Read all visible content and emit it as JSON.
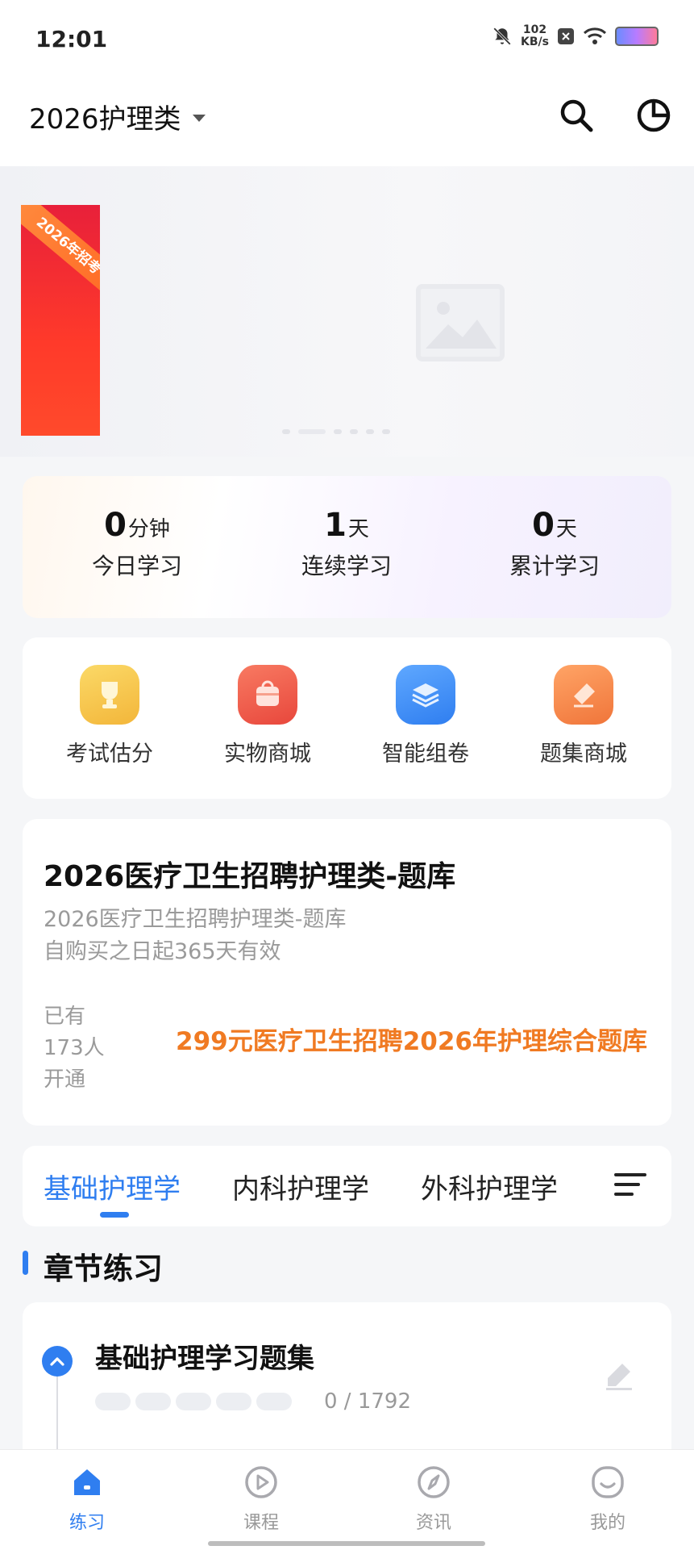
{
  "status_bar": {
    "time": "12:01",
    "net_speed_value": "102",
    "net_speed_unit": "KB/s"
  },
  "header": {
    "category": "2026护理类",
    "search_icon": "search-icon",
    "stats_icon": "pie-chart-icon"
  },
  "banner": {
    "promo_ribbon": "2026年招考"
  },
  "stats": [
    {
      "value": "0",
      "unit": "分钟",
      "label": "今日学习"
    },
    {
      "value": "1",
      "unit": "天",
      "label": "连续学习"
    },
    {
      "value": "0",
      "unit": "天",
      "label": "累计学习"
    }
  ],
  "quick_menu": [
    {
      "label": "考试估分",
      "icon": "trophy-icon",
      "color": "#f7c64a"
    },
    {
      "label": "实物商城",
      "icon": "bag-icon",
      "color": "#f0574a"
    },
    {
      "label": "智能组卷",
      "icon": "layers-icon",
      "color": "#3c8ef5"
    },
    {
      "label": "题集商城",
      "icon": "eraser-icon",
      "color": "#f58a4a"
    }
  ],
  "product": {
    "title": "2026医疗卫生招聘护理类-题库",
    "subtitle": "2026医疗卫生招聘护理类-题库",
    "validity": "自购买之日起365天有效",
    "buyers_line1": "已有",
    "buyers_line2": "173人",
    "buyers_line3": "开通",
    "price_text": "299元医疗卫生招聘2026年护理综合题库"
  },
  "tabs": [
    {
      "label": "基础护理学"
    },
    {
      "label": "内科护理学"
    },
    {
      "label": "外科护理学"
    }
  ],
  "section": {
    "title": "章节练习"
  },
  "chapter": {
    "title": "基础护理学习题集",
    "count": "0 / 1792"
  },
  "bottom_nav": [
    {
      "label": "练习",
      "icon": "home-icon"
    },
    {
      "label": "课程",
      "icon": "play-icon"
    },
    {
      "label": "资讯",
      "icon": "compass-icon"
    },
    {
      "label": "我的",
      "icon": "smile-icon"
    }
  ],
  "colors": {
    "accent": "#2f7ef0",
    "price": "#f07a22"
  }
}
